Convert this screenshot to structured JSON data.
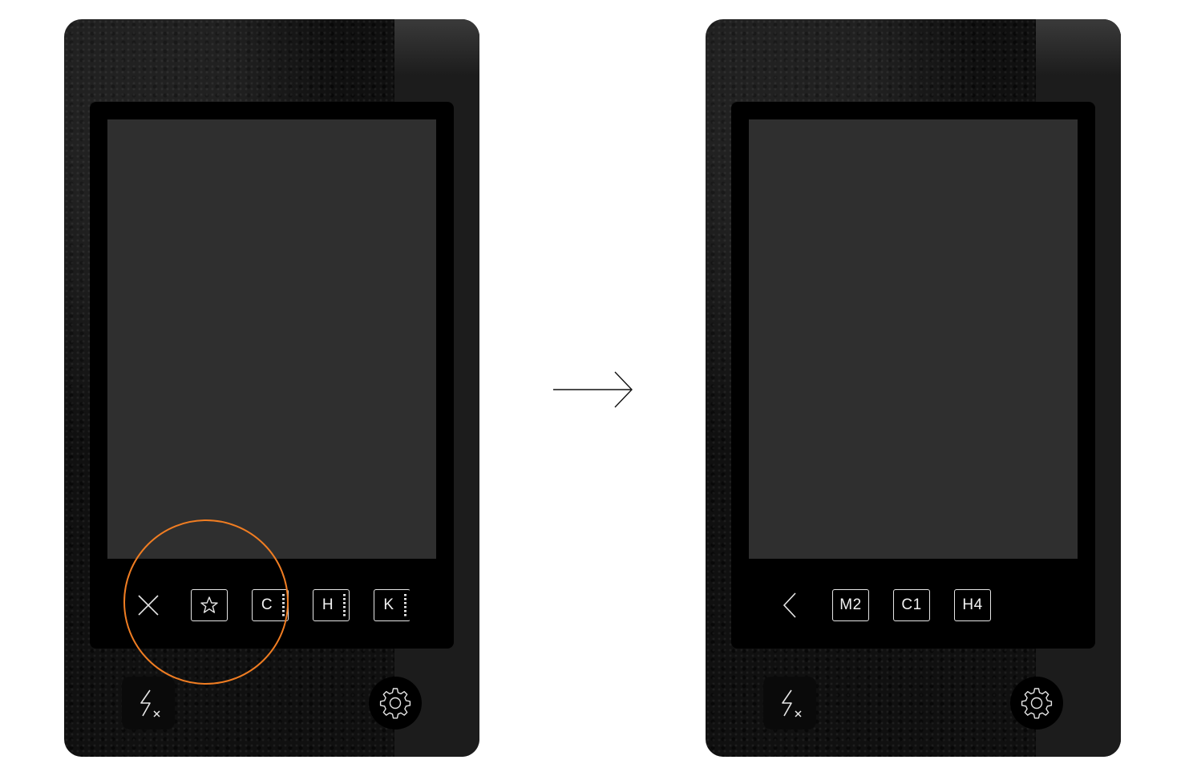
{
  "colors": {
    "highlight": "#f07d22",
    "viewfinder": "#2f2f2f",
    "page_background": "#ffffff"
  },
  "left_phone": {
    "toolbar": [
      {
        "type": "icon",
        "icon": "close-icon"
      },
      {
        "type": "icon",
        "icon": "star-icon"
      },
      {
        "type": "label",
        "label": "C",
        "dotted_scrollbar": true
      },
      {
        "type": "label",
        "label": "H",
        "dotted_scrollbar": true
      },
      {
        "type": "label",
        "label": "K",
        "dotted_scrollbar": true
      }
    ],
    "flash_icon": "flash-off-icon",
    "settings_icon": "gear-icon"
  },
  "right_phone": {
    "toolbar": [
      {
        "type": "icon",
        "icon": "chevron-left-icon"
      },
      {
        "type": "label",
        "label": "M2"
      },
      {
        "type": "label",
        "label": "C1"
      },
      {
        "type": "label",
        "label": "H4"
      }
    ],
    "flash_icon": "flash-off-icon",
    "settings_icon": "gear-icon"
  },
  "transition_icon": "arrow-right-icon"
}
